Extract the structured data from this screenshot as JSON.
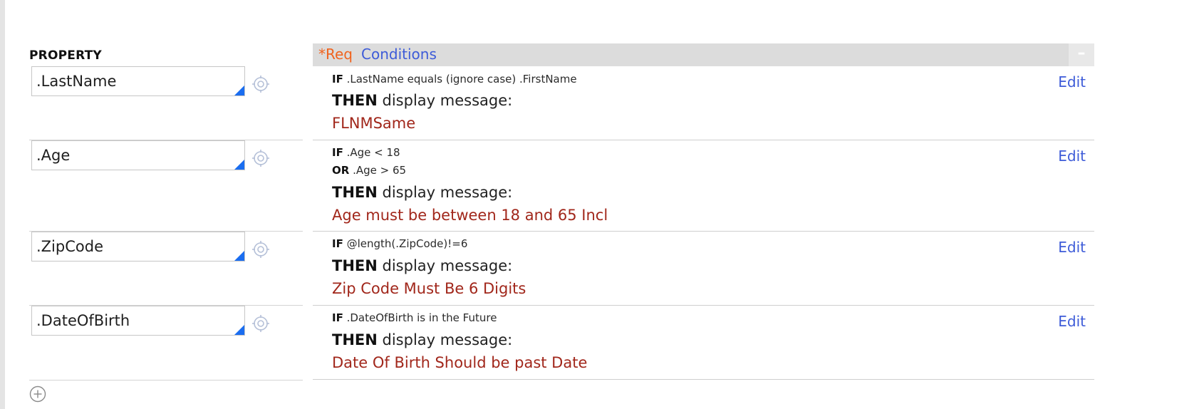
{
  "property_column": {
    "heading": "PROPERTY",
    "properties": [
      ".LastName",
      ".Age",
      ".ZipCode",
      ".DateOfBirth"
    ]
  },
  "conditions": {
    "required_marker": "*Req",
    "title": "Conditions",
    "collapse_label": "–",
    "then_keyword": "THEN",
    "then_text": "display message:",
    "edit_label": "Edit",
    "rules": [
      {
        "if_keyword": "IF",
        "if_text": ".LastName equals (ignore case) .FirstName",
        "message": "FLNMSame"
      },
      {
        "if_keyword": "IF",
        "if_text": ".Age < 18",
        "or_keyword": "OR",
        "or_text": ".Age > 65",
        "message": "Age must be between 18 and 65 Incl"
      },
      {
        "if_keyword": "IF",
        "if_text": "@length(.ZipCode)!=6",
        "message": "Zip Code Must Be 6 Digits"
      },
      {
        "if_keyword": "IF",
        "if_text": ".DateOfBirth is in the Future",
        "message": "Date Of Birth Should be past Date"
      }
    ]
  },
  "colors": {
    "accent_blue": "#3d5bd8",
    "required_orange": "#f0631e",
    "message_red": "#a1271b",
    "field_corner_blue": "#1a6df0"
  },
  "icons": {
    "property_picker": "target-icon",
    "add_row": "plus-circle-icon"
  }
}
